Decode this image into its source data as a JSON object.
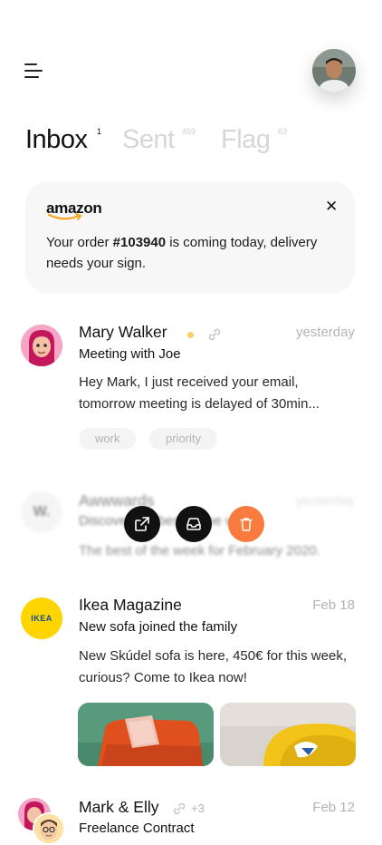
{
  "header": {
    "menu_icon": "hamburger-icon",
    "avatar": "user-avatar"
  },
  "tabs": [
    {
      "label": "Inbox",
      "count": "1",
      "active": true
    },
    {
      "label": "Sent",
      "count": "459",
      "active": false
    },
    {
      "label": "Flag",
      "count": "63",
      "active": false
    }
  ],
  "notification": {
    "brand": "amazon",
    "close_icon": "close-icon",
    "text_before": "Your order ",
    "order_number": "#103940",
    "text_after": " is coming today, delivery needs your sign."
  },
  "emails": [
    {
      "sender": "Mary Walker",
      "subject": "Meeting with Joe",
      "preview": "Hey Mark, I just received your email, tomorrow meeting is delayed of 30min...",
      "date": "yesterday",
      "tags": [
        "work",
        "priority"
      ],
      "unread_color": "#f7d064"
    },
    {
      "avatar_letter": "W.",
      "sender": "Awwwards",
      "subject": "Discover the best of the week",
      "preview": "The best of the week for February 2020.",
      "date": "yesterday",
      "actions": [
        "open-external-icon",
        "archive-inbox-icon",
        "trash-icon"
      ],
      "delete_color": "#f97b3d"
    },
    {
      "avatar_text": "IKEA",
      "sender": "Ikea Magazine",
      "subject": "New sofa joined the family",
      "preview": "New Skúdel sofa is here, 450€ for this week, curious? Come to Ikea now!",
      "date": "Feb 18"
    },
    {
      "sender": "Mark & Elly",
      "attachments_extra": "+3",
      "subject": "Freelance Contract",
      "date": "Feb 12"
    }
  ]
}
